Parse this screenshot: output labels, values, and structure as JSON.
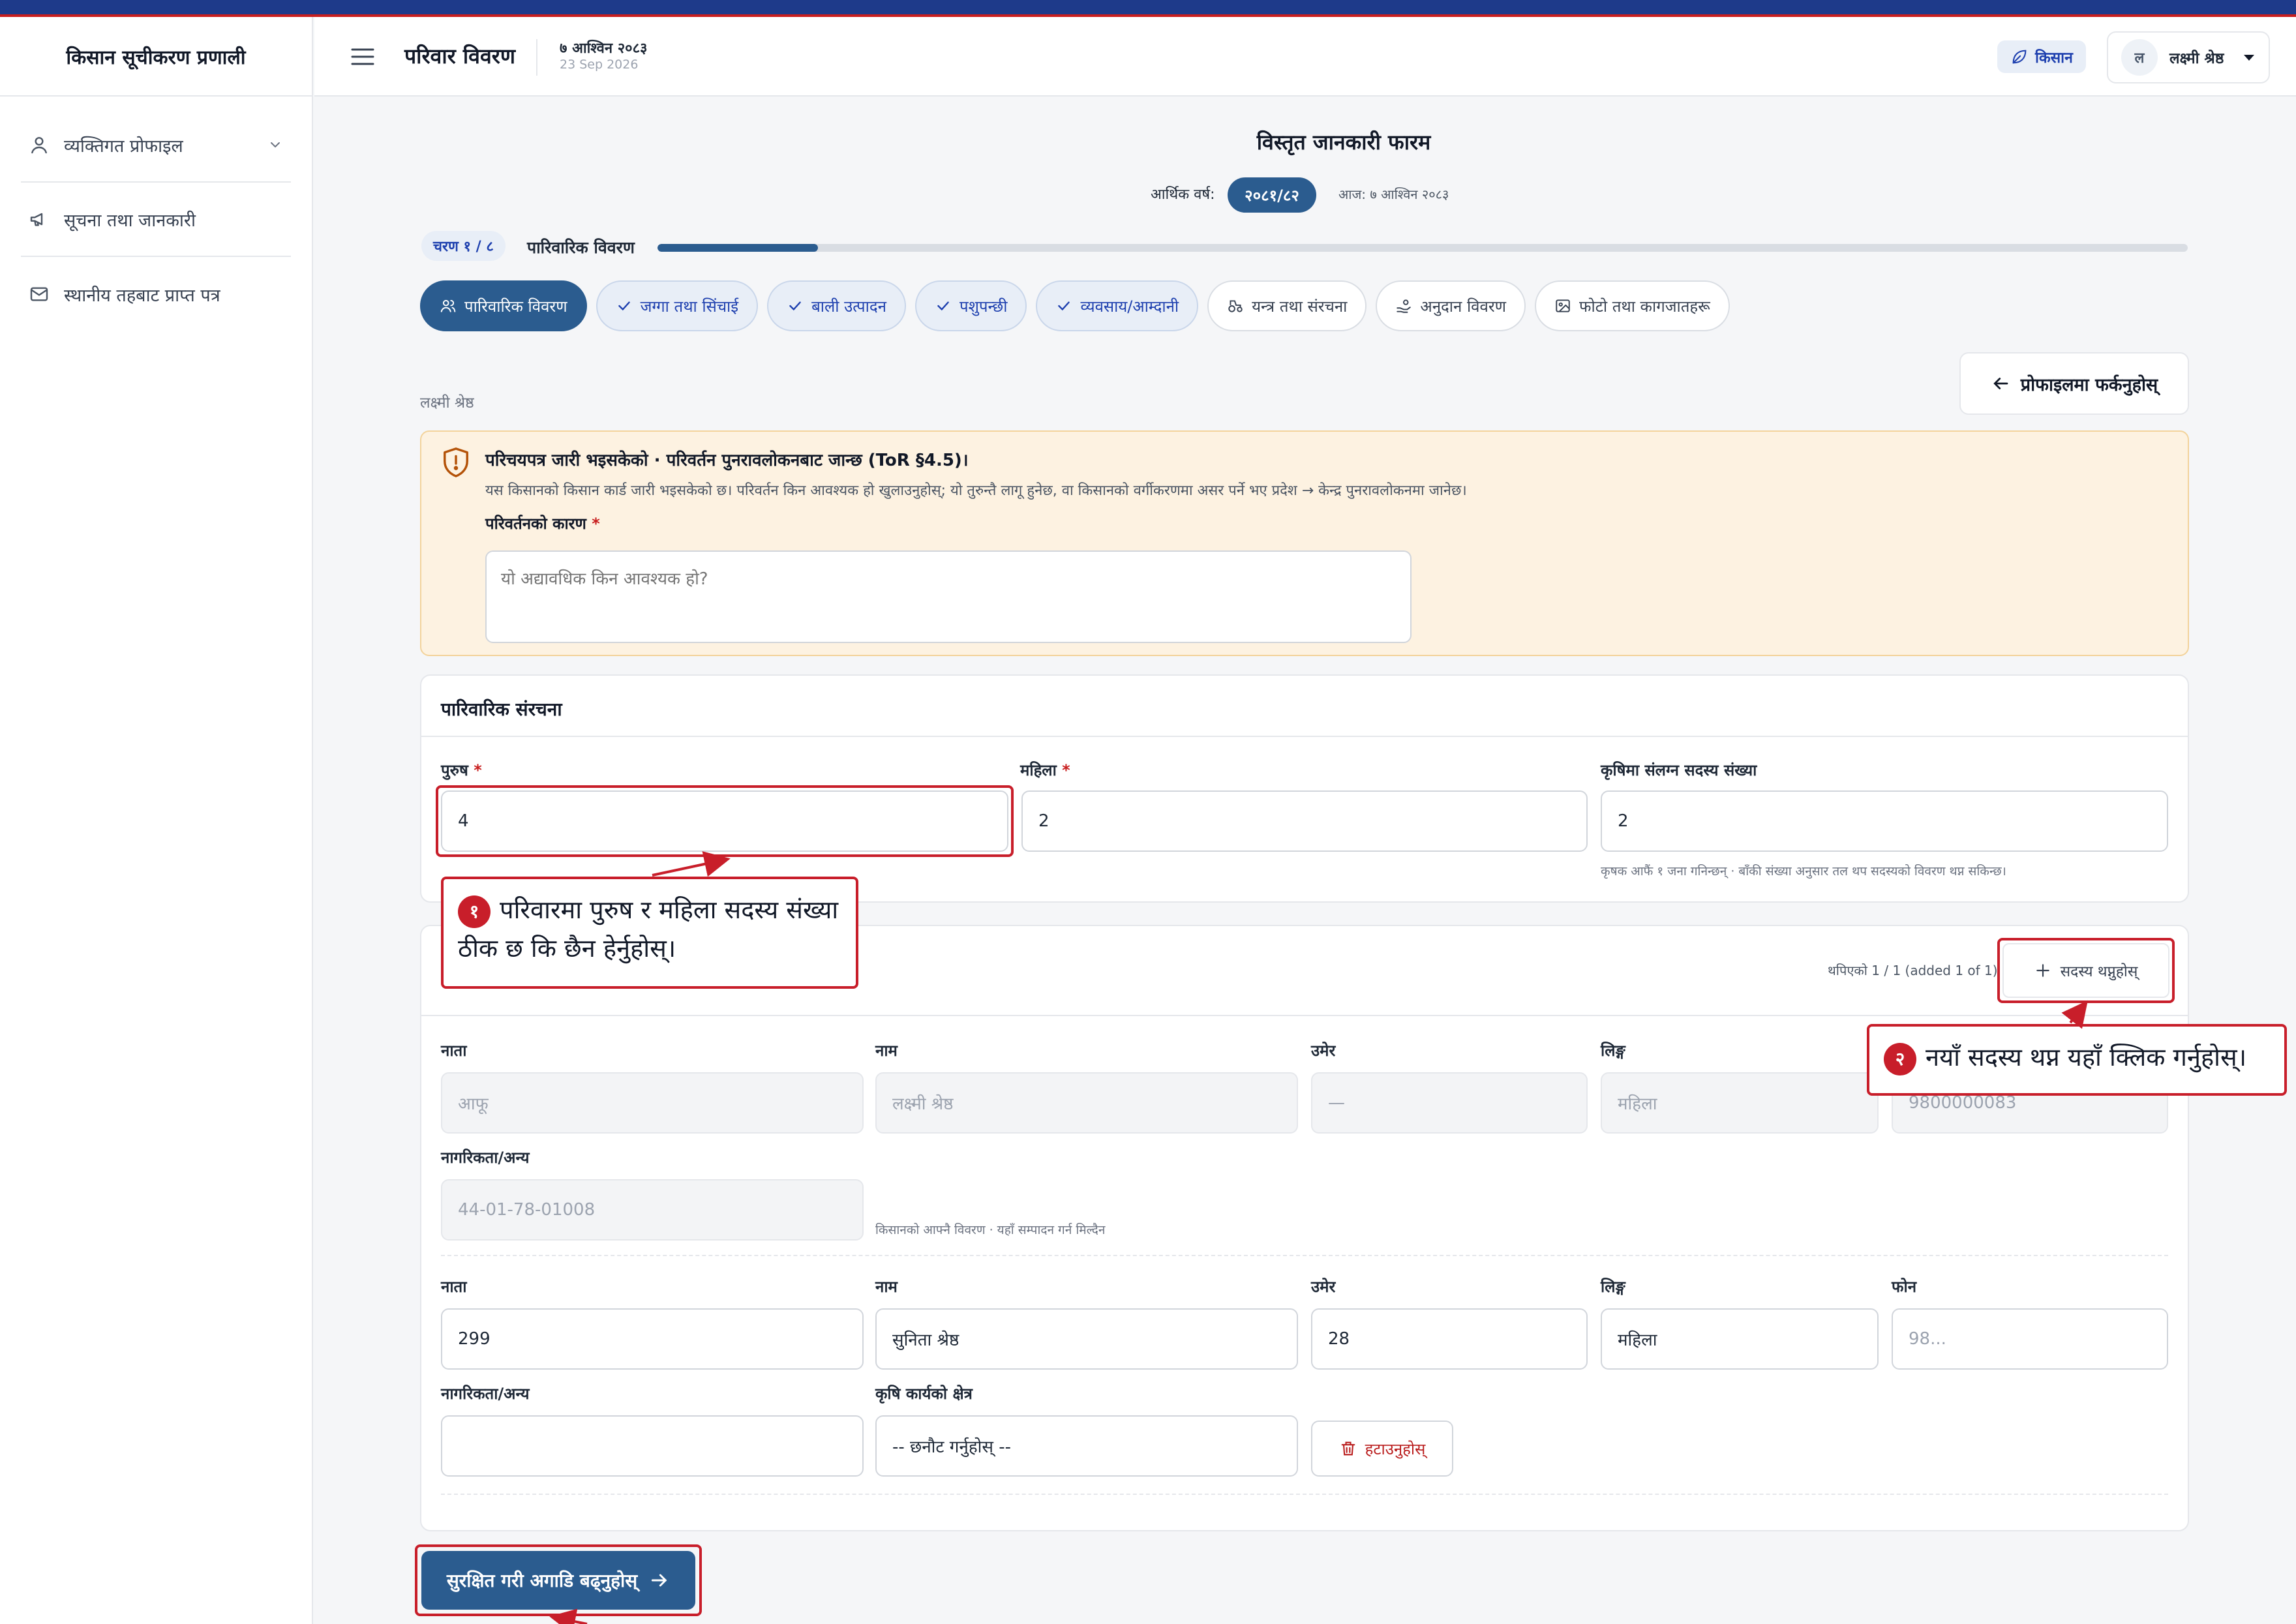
{
  "app": {
    "title": "किसान सूचीकरण प्रणाली"
  },
  "sidebar": {
    "items": [
      {
        "label": "व्यक्तिगत प्रोफाइल",
        "icon": "user-icon",
        "has_chevron": true
      },
      {
        "label": "सूचना तथा जानकारी",
        "icon": "megaphone-icon"
      },
      {
        "label": "स्थानीय तहबाट प्राप्त पत्र",
        "icon": "mail-icon"
      }
    ]
  },
  "header": {
    "title": "परिवार विवरण",
    "date_np": "७ आश्विन २०८३",
    "date_en": "23 Sep 2026",
    "role": "किसान",
    "user": {
      "initial": "ल",
      "name": "लक्ष्मी श्रेष्ठ"
    }
  },
  "form": {
    "title": "विस्तृत जानकारी फारम",
    "fiscal_label": "आर्थिक वर्ष:",
    "fiscal_year": "२०८१/८२",
    "today": "आज: ७ आश्विन २०८३",
    "step": {
      "badge": "चरण १ / ८",
      "name": "पारिवारिक विवरण",
      "progress": 0.105
    },
    "tabs": [
      {
        "label": "पारिवारिक विवरण",
        "state": "active",
        "icon": "users-icon"
      },
      {
        "label": "जग्गा तथा सिंचाई",
        "state": "done",
        "icon": "check-icon"
      },
      {
        "label": "बाली उत्पादन",
        "state": "done",
        "icon": "check-icon"
      },
      {
        "label": "पशुपन्छी",
        "state": "done",
        "icon": "check-icon"
      },
      {
        "label": "व्यवसाय/आम्दानी",
        "state": "done",
        "icon": "check-icon"
      },
      {
        "label": "यन्त्र तथा संरचना",
        "state": "todo",
        "icon": "tractor-icon"
      },
      {
        "label": "अनुदान विवरण",
        "state": "todo",
        "icon": "hand-coins-icon"
      },
      {
        "label": "फोटो तथा कागजातहरू",
        "state": "todo",
        "icon": "image-icon"
      }
    ],
    "owner_name": "लक्ष्मी श्रेष्ठ",
    "back_label": "प्रोफाइलमा फर्कनुहोस्"
  },
  "warning": {
    "title": "परिचयपत्र जारी भइसकेको · परिवर्तन पुनरावलोकनबाट जान्छ (ToR §4.5)।",
    "description": "यस किसानको किसान कार्ड जारी भइसकेको छ। परिवर्तन किन आवश्यक हो खुलाउनुहोस्; यो तुरुन्तै लागू हुनेछ, वा किसानको वर्गीकरणमा असर पर्ने भए प्रदेश → केन्द्र पुनरावलोकनमा जानेछ।",
    "reason_label": "परिवर्तनको कारण",
    "reason_placeholder": "यो अद्यावधिक किन आवश्यक हो?"
  },
  "family": {
    "title": "पारिवारिक संरचना",
    "male_label": "पुरुष",
    "male_value": "4",
    "female_label": "महिला",
    "female_value": "2",
    "agri_label": "कृषिमा संलग्न सदस्य संख्या",
    "agri_value": "2",
    "agri_hint": "कृषक आफैं १ जना गनिन्छन् · बाँकी संख्या अनुसार तल थप सदस्यको विवरण थप्न सकिन्छ।"
  },
  "members": {
    "count_text": "थपिएको 1 / 1 (added 1 of 1)",
    "add_label": "सदस्य थप्नुहोस्",
    "col_relation": "नाता",
    "col_name": "नाम",
    "col_age": "उमेर",
    "col_gender": "लिङ्ग",
    "col_phone": "फोन",
    "col_citizenship": "नागरिकता/अन्य",
    "col_agri_area": "कृषि कार्यको क्षेत्र",
    "self": {
      "relation": "आफू",
      "name": "लक्ष्मी श्रेष्ठ",
      "age": "—",
      "gender": "महिला",
      "phone": "9800000083",
      "citizenship": "44-01-78-01008",
      "note": "किसानको आफ्नै विवरण · यहाँ सम्पादन गर्न मिल्दैन"
    },
    "member": {
      "relation": "299",
      "name": "सुनिता श्रेष्ठ",
      "age": "28",
      "gender": "महिला",
      "phone_placeholder": "98...",
      "citizenship": "",
      "agri_area_placeholder": "-- छनौट गर्नुहोस् --",
      "remove_label": "हटाउनुहोस्"
    }
  },
  "save_label": "सुरक्षित गरी अगाडि बढ्नुहोस्",
  "annotations": [
    {
      "num": "१",
      "text": "परिवारमा पुरुष र महिला सदस्य संख्या ठीक छ कि छैन हेर्नुहोस्।"
    },
    {
      "num": "२",
      "text": "नयाँ सदस्य थप्न यहाँ क्लिक गर्नुहोस्।"
    }
  ],
  "colors": {
    "primary": "#2b5c8f",
    "annotation": "#c81e2a",
    "warning_bg": "#fdf2e1",
    "danger": "#b91c1c"
  }
}
